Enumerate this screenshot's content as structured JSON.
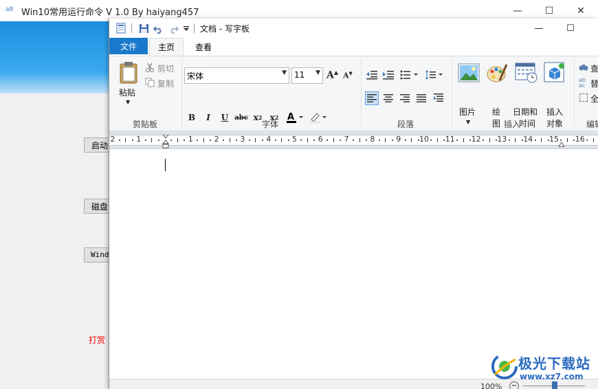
{
  "back_window": {
    "app_icon": "a8",
    "title": "Win10常用运行命令 V 1.0  By haiyang457",
    "controls": {
      "minimize": "—",
      "maximize": "☐",
      "close": "✕"
    },
    "buttons": [
      {
        "label": "启动"
      },
      {
        "label": "磁盘"
      },
      {
        "label": "Windows"
      }
    ],
    "reward_link": "打赏",
    "banner_color": "#1c8fe0"
  },
  "wordpad": {
    "title": "文档 - 写字板",
    "quick_access": [
      "wordpad-icon",
      "save-icon",
      "undo-icon",
      "redo-icon",
      "customize-qat-icon"
    ],
    "controls": {
      "minimize": "—",
      "maximize": "☐"
    },
    "tabs": {
      "file": "文件",
      "home": "主页",
      "view": "查看"
    },
    "clipboard": {
      "paste": "粘贴",
      "cut": "剪切",
      "copy": "复制",
      "group": "剪贴板"
    },
    "font": {
      "family": "宋体",
      "size": "11",
      "group": "字体"
    },
    "paragraph": {
      "group": "段落"
    },
    "insert": {
      "picture": "图片",
      "paint_1": "绘",
      "paint_2": "图",
      "datetime_1": "日期和",
      "datetime_2": "时间",
      "object_1": "插入",
      "object_2": "对象",
      "group": "插入"
    },
    "editing": {
      "find": "查",
      "replace": "替",
      "select_all": "全",
      "group": "编辑"
    },
    "ruler": [
      "2",
      "1",
      "1",
      "2",
      "3",
      "4",
      "5",
      "6",
      "7",
      "8",
      "9",
      "10",
      "11",
      "12",
      "13",
      "14",
      "15",
      "16"
    ],
    "status": {
      "zoom": "100%"
    },
    "accent_color": "#1979ca"
  },
  "watermark": {
    "title": "极光下载站",
    "url": "www.xz7.com"
  }
}
